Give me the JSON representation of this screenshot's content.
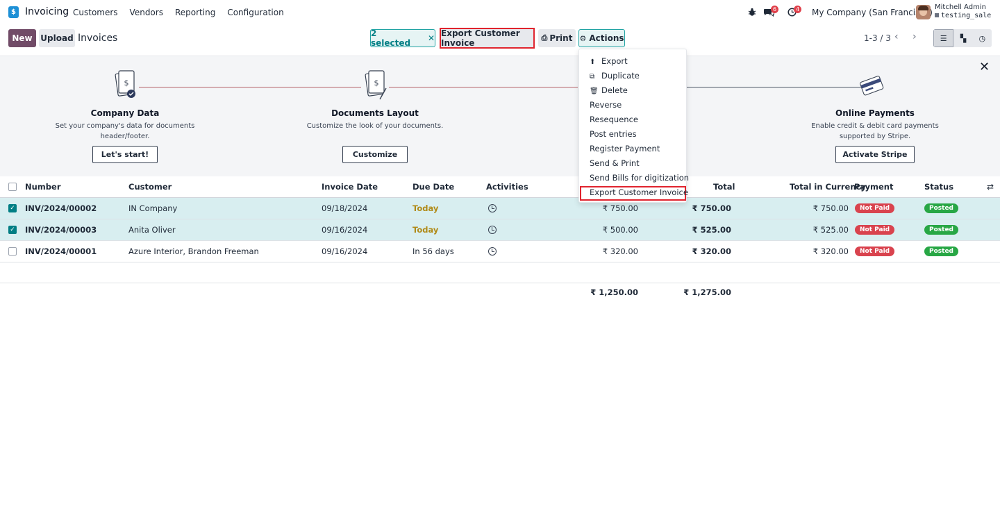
{
  "app": {
    "name": "Invoicing",
    "logo_letter": "$"
  },
  "nav": {
    "items": [
      "Customers",
      "Vendors",
      "Reporting",
      "Configuration"
    ]
  },
  "systray": {
    "bug_icon": "bug-icon",
    "messages_badge": "6",
    "activities_badge": "4",
    "company": "My Company (San Francisco)",
    "user_name": "Mitchell Admin",
    "database": "testing_sale"
  },
  "control": {
    "new_label": "New",
    "upload_label": "Upload",
    "title": "Invoices",
    "selected_label": "2 selected",
    "export_label": "Export Customer Invoice",
    "print_label": "Print",
    "actions_label": "Actions",
    "pager": "1-3 / 3"
  },
  "banner": {
    "steps": [
      {
        "title": "Company Data",
        "desc": "Set your company's data for documents header/footer.",
        "button": "Let's start!"
      },
      {
        "title": "Documents Layout",
        "desc": "Customize the look of your documents.",
        "button": "Customize"
      },
      {
        "title": "Online Payments",
        "desc": "Enable credit & debit card payments supported by Stripe.",
        "button": "Activate Stripe"
      }
    ]
  },
  "table": {
    "headers": {
      "number": "Number",
      "customer": "Customer",
      "invoice_date": "Invoice Date",
      "due_date": "Due Date",
      "activities": "Activities",
      "total": "Total",
      "total_currency": "Total in Currency",
      "payment": "Payment",
      "status": "Status"
    },
    "rows": [
      {
        "number": "INV/2024/00002",
        "customer": "IN Company",
        "invoice_date": "09/18/2024",
        "due_date": "Today",
        "untaxed": "₹ 750.00",
        "total": "₹ 750.00",
        "total_currency": "₹ 750.00",
        "payment": "Not Paid",
        "status": "Posted",
        "selected": true
      },
      {
        "number": "INV/2024/00003",
        "customer": "Anita Oliver",
        "invoice_date": "09/16/2024",
        "due_date": "Today",
        "untaxed": "₹ 500.00",
        "total": "₹ 525.00",
        "total_currency": "₹ 525.00",
        "payment": "Not Paid",
        "status": "Posted",
        "selected": true
      },
      {
        "number": "INV/2024/00001",
        "customer": "Azure Interior, Brandon Freeman",
        "invoice_date": "09/16/2024",
        "due_date": "In 56 days",
        "untaxed": "₹ 320.00",
        "total": "₹ 320.00",
        "total_currency": "₹ 320.00",
        "payment": "Not Paid",
        "status": "Posted",
        "selected": false
      }
    ],
    "totals": {
      "untaxed": "₹ 1,250.00",
      "total": "₹ 1,275.00"
    }
  },
  "actions_menu": {
    "items": [
      "Export",
      "Duplicate",
      "Delete",
      "Reverse",
      "Resequence",
      "Post entries",
      "Register Payment",
      "Send & Print",
      "Send Bills for digitization",
      "Export Customer Invoice"
    ]
  },
  "colors": {
    "brand": "#714b67",
    "accent": "#017e84",
    "highlight": "#e0242e",
    "not_paid": "#d9434e",
    "posted": "#28a745"
  }
}
